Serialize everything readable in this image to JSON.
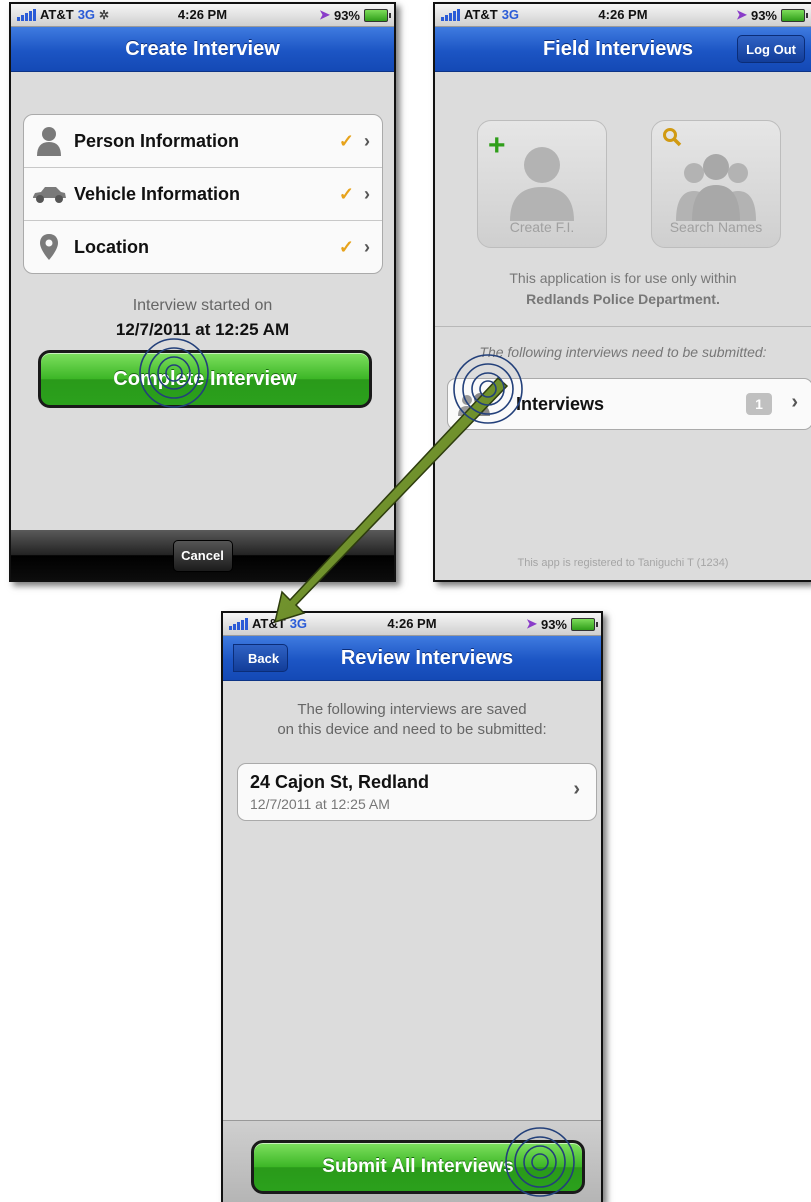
{
  "status": {
    "carrier": "AT&T",
    "network": "3G",
    "time": "4:26 PM",
    "battery": "93%"
  },
  "create_interview": {
    "title": "Create Interview",
    "items": [
      {
        "label": "Person Information",
        "icon": "person-icon"
      },
      {
        "label": "Vehicle Information",
        "icon": "car-icon"
      },
      {
        "label": "Location",
        "icon": "location-pin-icon"
      }
    ],
    "started_label": "Interview started on",
    "started_value": "12/7/2011 at 12:25 AM",
    "complete_button": "Complete Interview",
    "cancel_button": "Cancel"
  },
  "field_interviews": {
    "title": "Field Interviews",
    "logout_button": "Log Out",
    "create_tile": "Create F.I.",
    "search_tile": "Search Names",
    "notice_line1": "This application is for use only within",
    "notice_line2": "Redlands Police Department.",
    "pending_text": "The following interviews need to be submitted:",
    "interviews_label": "Interviews",
    "interviews_count": "1",
    "registered_text": "This app is registered to Taniguchi T (1234)"
  },
  "review_interviews": {
    "title": "Review Interviews",
    "back_button": "Back",
    "intro_line1": "The following interviews are saved",
    "intro_line2": "on this device and need to be submitted:",
    "entries": [
      {
        "address": "24 Cajon St, Redland",
        "date": "12/7/2011 at 12:25 AM"
      }
    ],
    "submit_button": "Submit All Interviews"
  },
  "colors": {
    "accent_checkmark": "#e7a31b",
    "navbar_blue": "#1c55c4",
    "button_green": "#3cb626",
    "arrow_green": "#6e8e2a"
  }
}
